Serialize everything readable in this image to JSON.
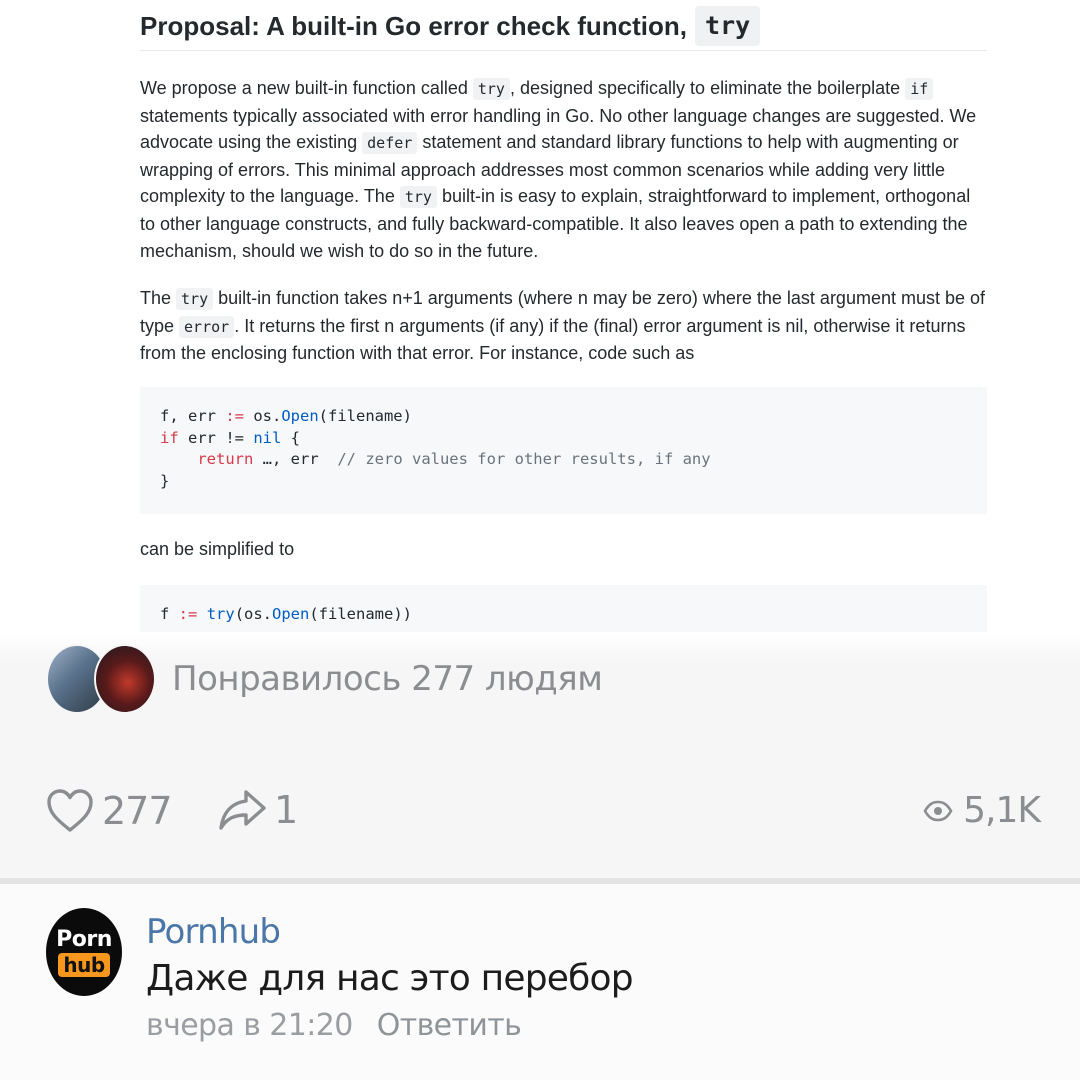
{
  "doc": {
    "title_text": "Proposal: A built-in Go error check function,",
    "title_code": "try",
    "p1": {
      "t1": "We propose a new built-in function called ",
      "c1": "try",
      "t2": ", designed specifically to eliminate the boilerplate ",
      "c2": "if",
      "t3": " statements typically associated with error handling in Go. No other language changes are suggested. We advocate using the existing ",
      "c3": "defer",
      "t4": " statement and standard library functions to help with augmenting or wrapping of errors. This minimal approach addresses most common scenarios while adding very little complexity to the language. The ",
      "c4": "try",
      "t5": " built-in is easy to explain, straightforward to implement, orthogonal to other language constructs, and fully backward-compatible. It also leaves open a path to extending the mechanism, should we wish to do so in the future."
    },
    "p2": {
      "t1": "The ",
      "c1": "try",
      "t2": " built-in function takes n+1 arguments (where n may be zero) where the last argument must be of type ",
      "c2": "error",
      "t3": ". It returns the first n arguments (if any) if the (final) error argument is nil, otherwise it returns from the enclosing function with that error. For instance, code such as"
    },
    "code1": {
      "l1a": "f, err ",
      "l1b": ":=",
      "l1c": " os.",
      "l1d": "Open",
      "l1e": "(filename)",
      "l2a": "if",
      "l2b": " err != ",
      "l2c": "nil",
      "l2d": " {",
      "l3a": "    ",
      "l3b": "return",
      "l3c": " …, err  ",
      "l3d": "// zero values for other results, if any",
      "l4": "}"
    },
    "p3": "can be simplified to",
    "code2": {
      "a": "f ",
      "b": ":=",
      "c": " ",
      "d": "try",
      "e": "(os.",
      "f": "Open",
      "g": "(filename))"
    }
  },
  "social": {
    "liked_text": "Понравилось 277 людям",
    "likes": "277",
    "shares": "1",
    "views": "5,1K"
  },
  "comment": {
    "avatar_top": "Porn",
    "avatar_bottom": "hub",
    "author": "Pornhub",
    "text": "Даже для нас это перебор",
    "time": "вчера в 21:20",
    "reply": "Ответить"
  },
  "colors": {
    "keyword": "#d73a49",
    "function": "#005cc5",
    "comment": "#6a737d",
    "author_link": "#4a76a8",
    "brand_orange": "#f7971d"
  }
}
